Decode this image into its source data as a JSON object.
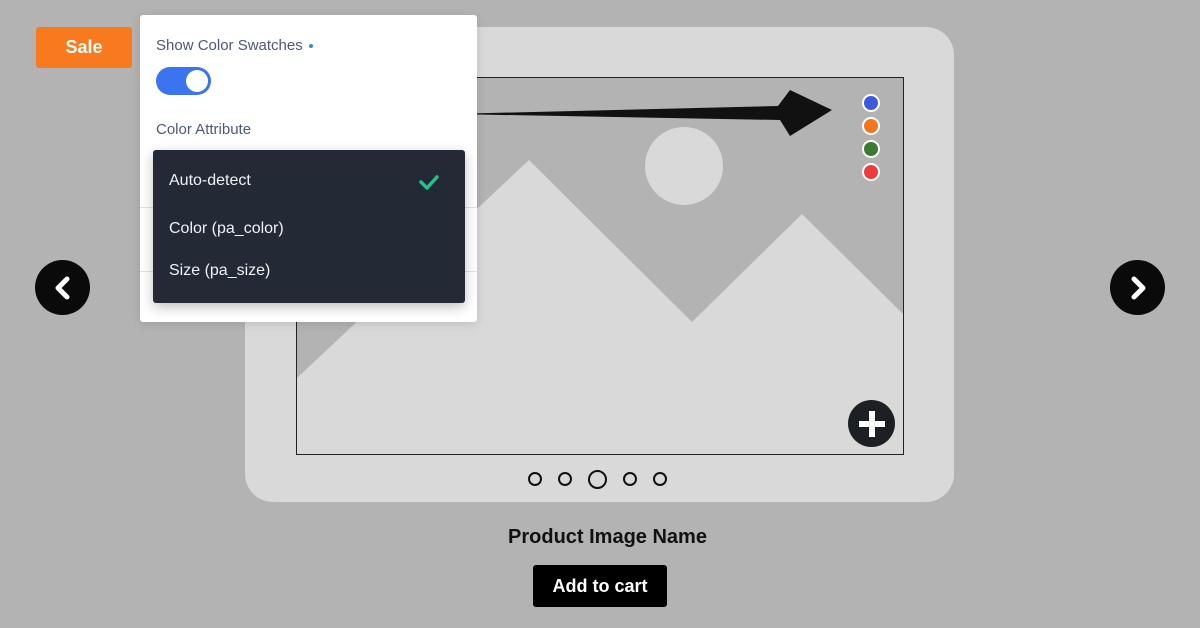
{
  "badge": {
    "sale_label": "Sale"
  },
  "settings_panel": {
    "swatch_label": "Show Color Swatches",
    "swatch_toggle_on": true,
    "attribute_label": "Color Attribute",
    "dropdown": {
      "options": [
        {
          "label": "Auto-detect",
          "selected": true
        },
        {
          "label": "Color (pa_color)",
          "selected": false
        },
        {
          "label": "Size (pa_size)",
          "selected": false
        }
      ]
    }
  },
  "gallery": {
    "swatch_colors": [
      "#3b5bdb",
      "#f5751f",
      "#3c7a2f",
      "#ef3b3b"
    ],
    "dots_count": 5,
    "active_dot": 3,
    "icons": {
      "prev": "chevron-left-icon",
      "next": "chevron-right-icon",
      "zoom": "plus-icon",
      "check": "checkmark-icon"
    }
  },
  "product": {
    "name": "Product Image Name",
    "add_to_cart_label": "Add to cart"
  },
  "colors": {
    "sale": "#f97a1e",
    "toggle": "#3b74f0",
    "dropdown_bg": "#232a36",
    "check": "#22c48a"
  }
}
